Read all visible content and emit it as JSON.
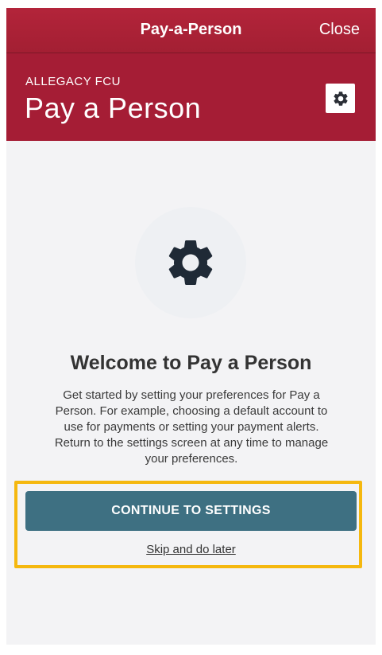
{
  "topbar": {
    "title": "Pay-a-Person",
    "close_label": "Close"
  },
  "header": {
    "org_name": "ALLEGACY FCU",
    "title": "Pay a Person",
    "settings_icon": "gear-icon"
  },
  "hero": {
    "icon": "gear-icon"
  },
  "welcome": {
    "title": "Welcome to Pay a Person",
    "body": "Get started by setting your preferences for Pay a Person. For example, choosing a default account to use for payments or setting your payment alerts. Return to the settings screen at any time to manage your preferences."
  },
  "actions": {
    "continue_label": "CONTINUE TO SETTINGS",
    "skip_label": "Skip and do later"
  },
  "colors": {
    "brand_red": "#a51d35",
    "button_teal": "#3e7082",
    "highlight_yellow": "#f5b80f",
    "background": "#f3f3f5"
  }
}
